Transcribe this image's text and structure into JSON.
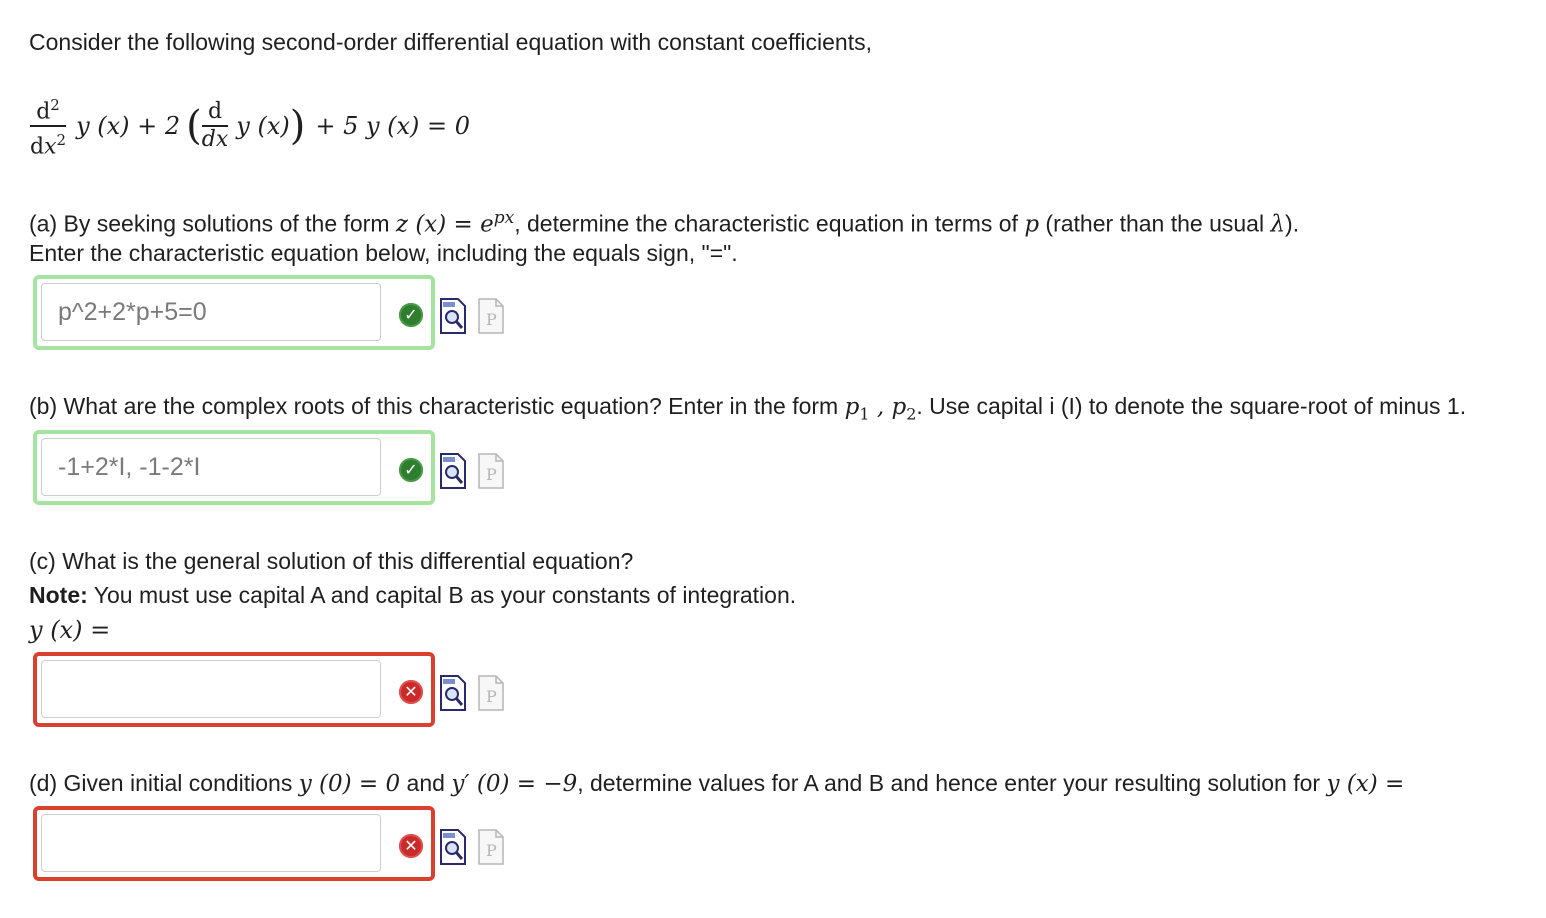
{
  "intro": "Consider the following second-order differential equation with constant coefficients,",
  "equation": {
    "d2_num": "d2",
    "d2_den": "dx2",
    "term1": "y (x) + 2",
    "d_num": "d",
    "d_den": "dx",
    "inner": "y (x)",
    "rest": "+ 5 y (x) = 0"
  },
  "part_a": {
    "prefix": "(a) By seeking solutions of the form ",
    "form_math": "z (x) = e",
    "form_sup": "px",
    "mid": ", determine the characteristic equation in terms of ",
    "p": "p",
    "suffix": " (rather than the usual ",
    "lambda": "λ",
    "end": ").",
    "line2": "Enter the characteristic equation below, including the equals sign, \"=\".",
    "answer": "p^2+2*p+5=0",
    "status": "correct"
  },
  "part_b": {
    "prefix": "(b) What are the complex roots of this characteristic equation? Enter in the form ",
    "p1": "p",
    "p1_sub": "1",
    "comma": " , ",
    "p2": "p",
    "p2_sub": "2",
    "suffix": ". Use capital i (I) to denote the square-root of minus 1.",
    "answer": "-1+2*I, -1-2*I",
    "status": "correct"
  },
  "part_c": {
    "line1": "(c) What is the general solution of this differential equation?",
    "note_label": "Note:",
    "note_text": " You must use capital A and capital B as your constants of integration.",
    "yx": "y (x) =",
    "answer": "",
    "status": "incorrect"
  },
  "part_d": {
    "prefix": "(d) Given initial conditions ",
    "cond1": "y (0) = 0",
    "and": " and ",
    "cond2": "y′ (0) = −9",
    "suffix": ", determine values for A and B and hence enter your resulting solution for ",
    "yx": "y (x) =",
    "answer": "",
    "status": "incorrect"
  },
  "icons": {
    "correct": "checkmark-icon",
    "incorrect": "cross-icon",
    "preview": "preview-magnifier-icon",
    "pdf": "pdf-document-icon",
    "colors": {
      "correct_border": "#a4e3a0",
      "incorrect_border": "#d9402f",
      "correct_fill": "#2f7d2f",
      "incorrect_fill": "#c92a2a"
    }
  },
  "status_glyphs": {
    "correct": "✓",
    "incorrect": "✕"
  }
}
